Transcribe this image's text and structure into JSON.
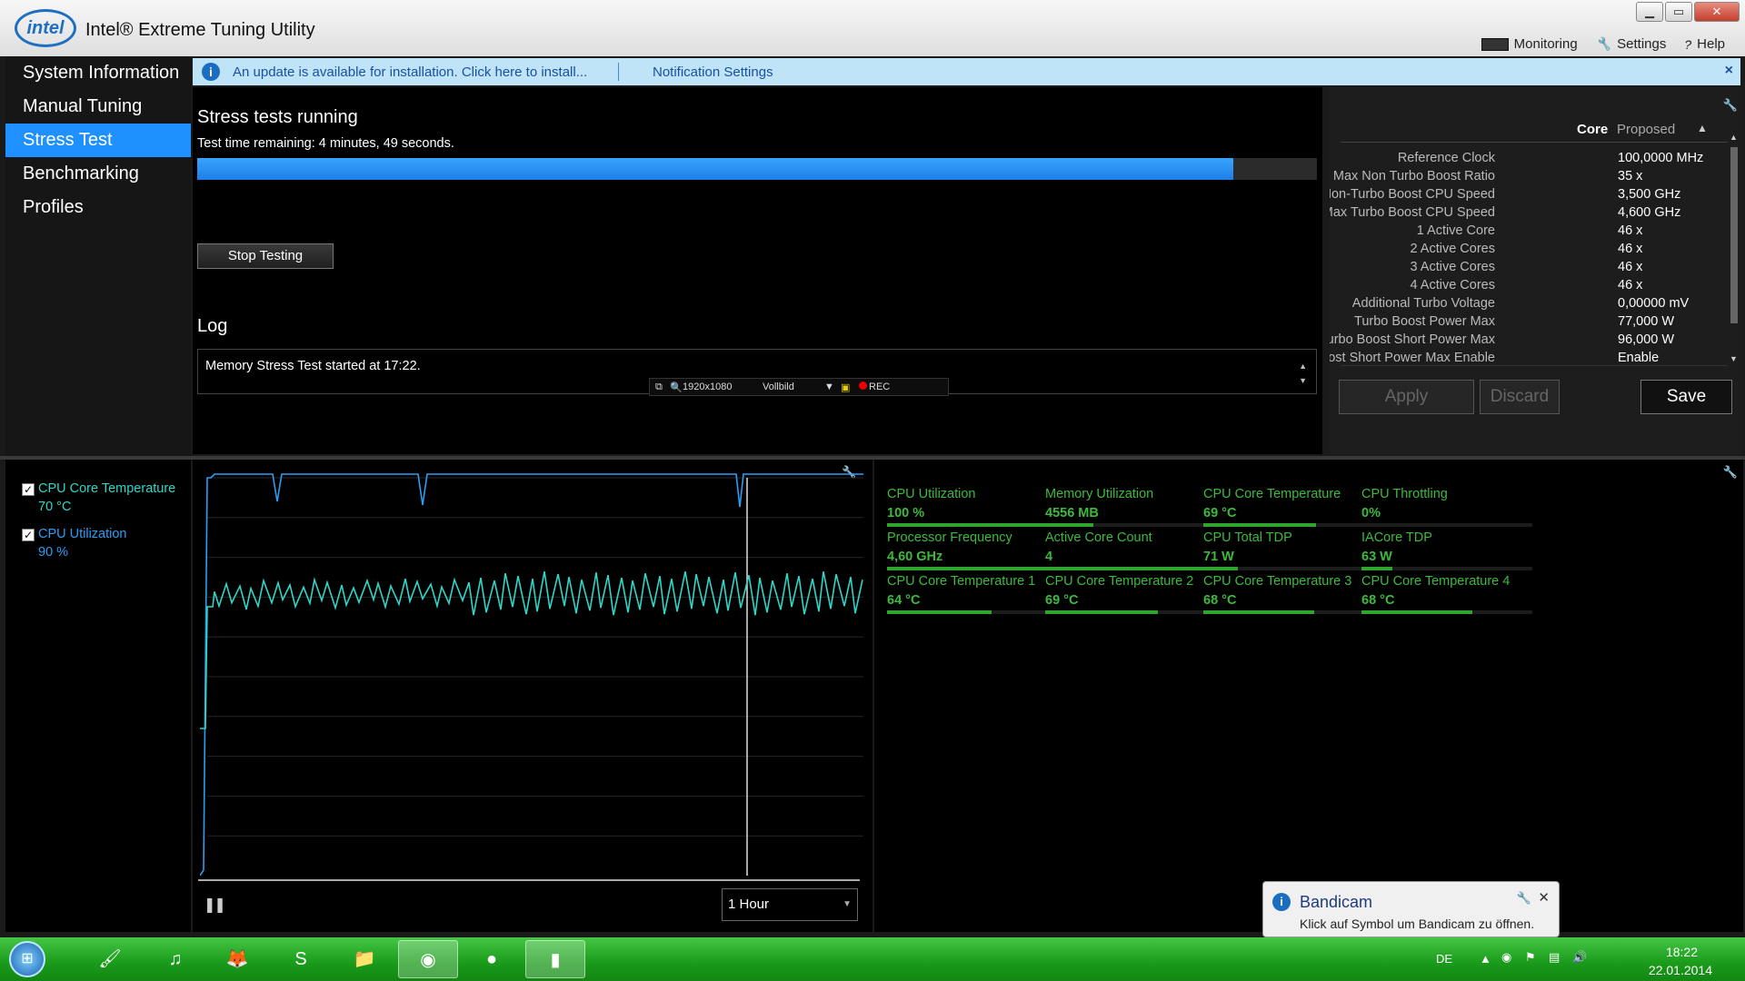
{
  "window": {
    "logo_text": "intel",
    "title": "Intel® Extreme Tuning Utility",
    "top_menu": {
      "monitoring": "Monitoring",
      "settings": "Settings",
      "help": "Help"
    }
  },
  "sidebar": {
    "items": [
      {
        "label": "System Information",
        "active": false
      },
      {
        "label": "Manual Tuning",
        "active": false
      },
      {
        "label": "Stress Test",
        "active": true
      },
      {
        "label": "Benchmarking",
        "active": false
      },
      {
        "label": "Profiles",
        "active": false
      }
    ]
  },
  "notification": {
    "message": "An update is available for installation. Click here to install...",
    "settings_link": "Notification Settings",
    "close": "×"
  },
  "stress": {
    "title": "Stress tests running",
    "remaining": "Test time remaining: 4 minutes, 49 seconds.",
    "progress_fraction": 0.925,
    "stop_button": "Stop Testing",
    "log_title": "Log",
    "log_text": "Memory Stress Test started at 17:22."
  },
  "recorder_bar": {
    "resolution": "1920x1080",
    "mode": "Vollbild",
    "rec": "REC"
  },
  "core_panel": {
    "col_core": "Core",
    "col_proposed": "Proposed",
    "rows": [
      {
        "label": "Reference Clock",
        "value": "100,0000 MHz"
      },
      {
        "label": "Max Non Turbo Boost Ratio",
        "value": "35 x"
      },
      {
        "label": "Max Non-Turbo Boost CPU Speed",
        "value": "3,500 GHz"
      },
      {
        "label": "Max Turbo Boost CPU Speed",
        "value": "4,600 GHz"
      },
      {
        "label": "1 Active Core",
        "value": "46 x"
      },
      {
        "label": "2 Active Cores",
        "value": "46 x"
      },
      {
        "label": "3 Active Cores",
        "value": "46 x"
      },
      {
        "label": "4 Active Cores",
        "value": "46 x"
      },
      {
        "label": "Additional Turbo Voltage",
        "value": "0,00000 mV"
      },
      {
        "label": "Turbo Boost Power Max",
        "value": "77,000 W"
      },
      {
        "label": "Turbo Boost Short Power Max",
        "value": "96,000 W"
      },
      {
        "label": "Turbo Boost Short Power Max Enable",
        "value": "Enable"
      }
    ],
    "apply": "Apply",
    "discard": "Discard",
    "save": "Save"
  },
  "legend": {
    "items": [
      {
        "name": "CPU Core Temperature",
        "value": "70 °C",
        "color": "#2fd6c8",
        "checked": true
      },
      {
        "name": "CPU Utilization",
        "value": "90 %",
        "color": "#2a9df4",
        "checked": true
      }
    ]
  },
  "graph": {
    "range": "1 Hour",
    "pause": "❚❚"
  },
  "metrics": [
    {
      "label": "CPU Utilization",
      "value": "100 %",
      "fill": 1.0
    },
    {
      "label": "Memory Utilization",
      "value": "4556  MB",
      "fill": 0.28
    },
    {
      "label": "CPU Core Temperature",
      "value": "69 °C",
      "fill": 0.66
    },
    {
      "label": "CPU Throttling",
      "value": "0%",
      "fill": 0.0
    },
    {
      "label": "Processor Frequency",
      "value": "4,60 GHz",
      "fill": 1.0
    },
    {
      "label": "Active Core Count",
      "value": "4",
      "fill": 1.0
    },
    {
      "label": "CPU Total TDP",
      "value": "71 W",
      "fill": 0.2
    },
    {
      "label": "IACore TDP",
      "value": "63 W",
      "fill": 0.18
    },
    {
      "label": "CPU Core Temperature 1",
      "value": "64 °C",
      "fill": 0.61
    },
    {
      "label": "CPU Core Temperature 2",
      "value": "69 °C",
      "fill": 0.66
    },
    {
      "label": "CPU Core Temperature 3",
      "value": "68 °C",
      "fill": 0.65
    },
    {
      "label": "CPU Core Temperature 4",
      "value": "68 °C",
      "fill": 0.65
    }
  ],
  "toast": {
    "title": "Bandicam",
    "message": "Klick auf Symbol um Bandicam zu öffnen."
  },
  "taskbar": {
    "apps": [
      "explorer-app",
      "spotify-app",
      "firefox-app",
      "skype-app",
      "folder-app",
      "chrome-app",
      "origin-app",
      "xtu-app"
    ],
    "language": "DE",
    "time": "18:22",
    "date": "22.01.2014"
  },
  "colors": {
    "accent": "#1e90ff",
    "metric_green": "#3cba3c",
    "temp_line": "#2fd6c8",
    "util_line": "#2a9df4"
  }
}
